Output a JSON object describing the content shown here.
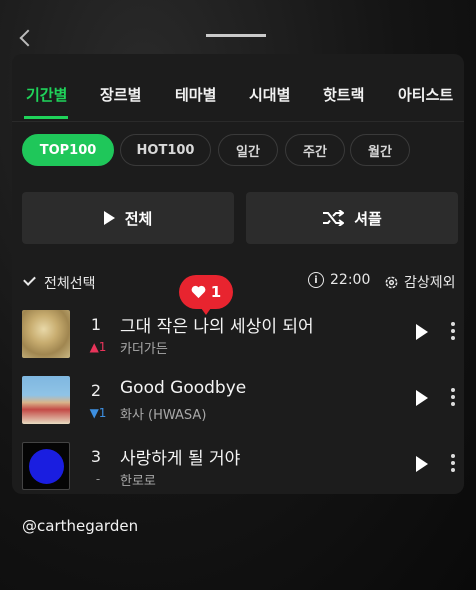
{
  "tabs": [
    "기간별",
    "장르별",
    "테마별",
    "시대별",
    "핫트랙",
    "아티스트"
  ],
  "active_tab": "기간별",
  "chips": [
    "TOP100",
    "HOT100",
    "일간",
    "주간",
    "월간"
  ],
  "active_chip": "TOP100",
  "actions": {
    "play_all": "전체",
    "shuffle": "셔플"
  },
  "select_bar": {
    "select_all": "전체선택",
    "timer": "22:00",
    "exclude": "감상제외"
  },
  "like_bubble": {
    "count": "1"
  },
  "songs": [
    {
      "rank": "1",
      "delta": "1",
      "delta_dir": "up",
      "title": "그대 작은 나의 세상이 되어",
      "artist": "카더가든"
    },
    {
      "rank": "2",
      "delta": "1",
      "delta_dir": "down",
      "title": "Good Goodbye",
      "artist": "화사 (HWASA)"
    },
    {
      "rank": "3",
      "delta": "-",
      "delta_dir": "same",
      "title": "사랑하게 될 거야",
      "artist": "한로로"
    }
  ],
  "footer": {
    "handle": "@carthegarden"
  },
  "colors": {
    "accent": "#1fd35a",
    "chip_active": "#1fc75a",
    "up": "#e8345a",
    "down": "#3d8fe0",
    "bubble": "#e8242f"
  }
}
